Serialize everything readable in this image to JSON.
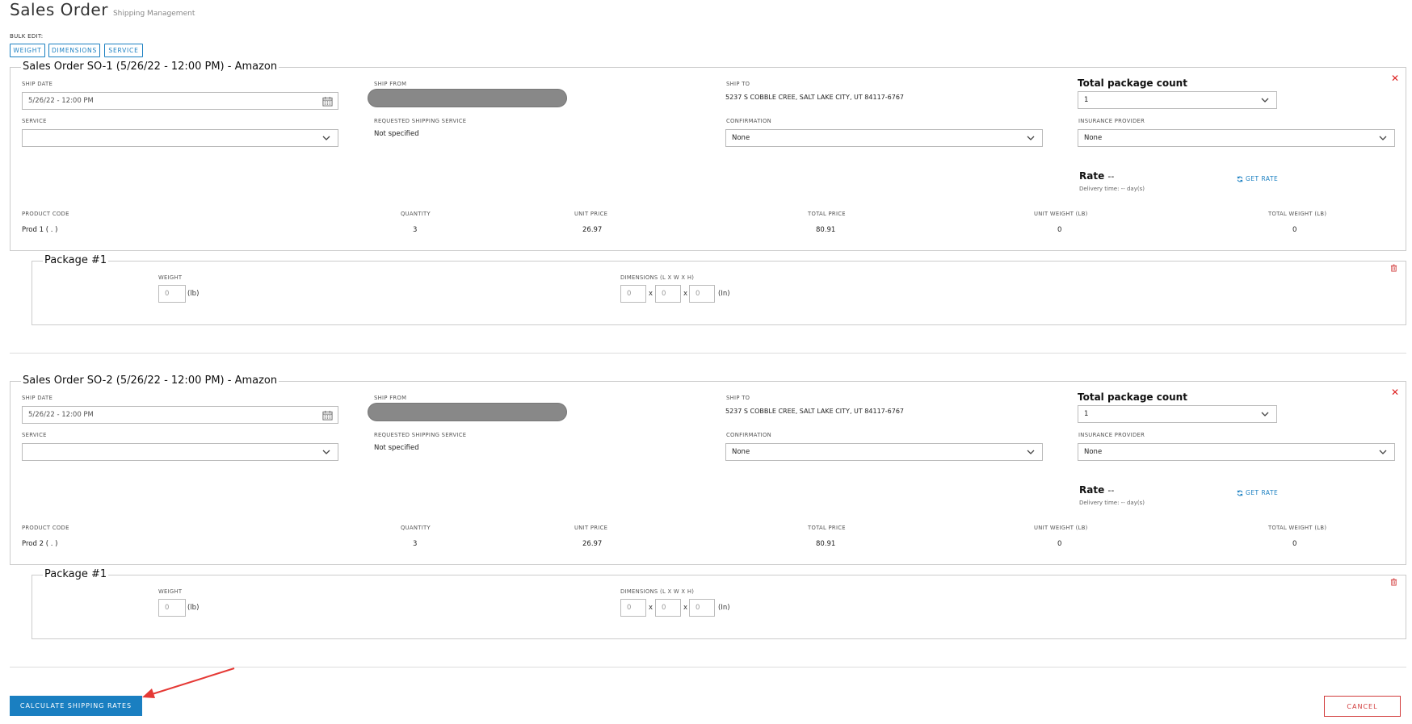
{
  "page": {
    "title": "Sales Order",
    "subtitle": "Shipping Management"
  },
  "bulk_edit": {
    "label": "BULK EDIT:",
    "buttons": [
      "WEIGHT",
      "DIMENSIONS",
      "SERVICE"
    ]
  },
  "labels": {
    "ship_date": "SHIP DATE",
    "ship_from": "SHIP FROM",
    "ship_to": "SHIP TO",
    "total_package_count": "Total package count",
    "service": "SERVICE",
    "requested_shipping_service": "REQUESTED SHIPPING SERVICE",
    "confirmation": "CONFIRMATION",
    "insurance_provider": "INSURANCE PROVIDER",
    "rate": "Rate",
    "rate_value": "--",
    "delivery_time": "Delivery time: -- day(s)",
    "get_rate": "GET RATE",
    "columns": [
      "PRODUCT CODE",
      "QUANTITY",
      "UNIT PRICE",
      "TOTAL PRICE",
      "UNIT WEIGHT (LB)",
      "TOTAL WEIGHT (LB)"
    ],
    "weight": "WEIGHT",
    "dimensions": "DIMENSIONS (L X W X H)",
    "lb_unit": "(lb)",
    "in_unit": "(In)",
    "x": "x"
  },
  "orders": [
    {
      "legend": "Sales Order SO-1 (5/26/22 - 12:00 PM) - Amazon",
      "ship_date": "5/26/22 - 12:00 PM",
      "ship_to": "5237 S COBBLE CREE, SALT LAKE CITY, UT 84117-6767",
      "total_package_count": "1",
      "service": "",
      "requested_service": "Not specified",
      "confirmation": "None",
      "insurance_provider": "None",
      "row": [
        "Prod 1 ( . )",
        "3",
        "26.97",
        "80.91",
        "0",
        "0"
      ],
      "package": {
        "legend": "Package #1",
        "weight": "0",
        "l": "0",
        "w": "0",
        "h": "0"
      }
    },
    {
      "legend": "Sales Order SO-2 (5/26/22 - 12:00 PM) - Amazon",
      "ship_date": "5/26/22 - 12:00 PM",
      "ship_to": "5237 S COBBLE CREE, SALT LAKE CITY, UT 84117-6767",
      "total_package_count": "1",
      "service": "",
      "requested_service": "Not specified",
      "confirmation": "None",
      "insurance_provider": "None",
      "row": [
        "Prod 2 ( . )",
        "3",
        "26.97",
        "80.91",
        "0",
        "0"
      ],
      "package": {
        "legend": "Package #1",
        "weight": "0",
        "l": "0",
        "w": "0",
        "h": "0"
      }
    }
  ],
  "footer": {
    "calculate": "CALCULATE SHIPPING RATES",
    "cancel": "CANCEL"
  },
  "colors": {
    "accent": "#1a7fc1",
    "danger": "#d23c3c",
    "annotation_arrow": "#e53935"
  }
}
